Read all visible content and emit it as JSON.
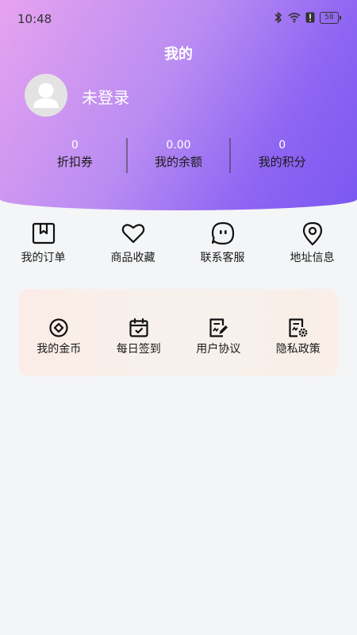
{
  "status_bar": {
    "time": "10:48",
    "battery": "58",
    "icons": [
      "bluetooth-icon",
      "wifi-icon",
      "alert-icon",
      "battery-icon"
    ]
  },
  "header": {
    "title": "我的"
  },
  "profile": {
    "login_text": "未登录",
    "avatar_icon": "user-avatar-icon"
  },
  "stats": [
    {
      "value": "0",
      "label": "折扣券"
    },
    {
      "value": "0.00",
      "label": "我的余额"
    },
    {
      "value": "0",
      "label": "我的积分"
    }
  ],
  "quick_actions": [
    {
      "label": "我的订单",
      "icon": "orders-box-icon"
    },
    {
      "label": "商品收藏",
      "icon": "heart-icon"
    },
    {
      "label": "联系客服",
      "icon": "chat-bubble-icon"
    },
    {
      "label": "地址信息",
      "icon": "location-pin-icon"
    }
  ],
  "services": [
    {
      "label": "我的金币",
      "icon": "coin-icon"
    },
    {
      "label": "每日签到",
      "icon": "calendar-check-icon"
    },
    {
      "label": "用户协议",
      "icon": "document-edit-icon"
    },
    {
      "label": "隐私政策",
      "icon": "document-settings-icon"
    }
  ],
  "colors": {
    "gradient_start": "#e7a3ef",
    "gradient_end": "#7a58f1",
    "card_bg": "#f9eee8",
    "page_bg": "#f4f5f7"
  }
}
